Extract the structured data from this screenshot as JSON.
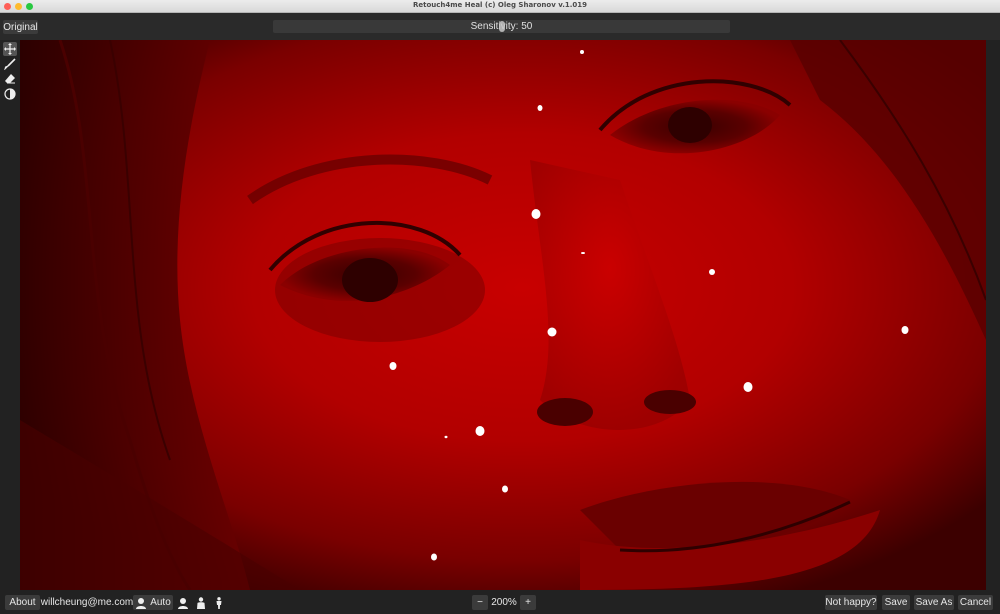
{
  "window": {
    "title": "Retouch4me Heal (c) Oleg Sharonov v.1.019"
  },
  "topbar": {
    "original_label": "Original",
    "sensitivity_label": "Sensitivity: 50",
    "sensitivity_value": 50
  },
  "tools": [
    {
      "name": "move-tool",
      "icon": "move-icon",
      "active": true
    },
    {
      "name": "brush-tool",
      "icon": "brush-icon",
      "active": false
    },
    {
      "name": "eraser-tool",
      "icon": "eraser-icon",
      "active": false
    },
    {
      "name": "mask-tool",
      "icon": "contrast-icon",
      "active": false
    }
  ],
  "bottombar": {
    "about_label": "About",
    "user_email": "willcheung@me.com",
    "auto_label": "Auto",
    "zoom_minus": "−",
    "zoom_value": "200%",
    "zoom_plus": "+",
    "not_happy_label": "Not happy?",
    "save_label": "Save",
    "save_as_label": "Save As",
    "cancel_label": "Cancel"
  },
  "colors": {
    "mask_overlay": "#c00000",
    "defect_marker": "#ffffff"
  }
}
